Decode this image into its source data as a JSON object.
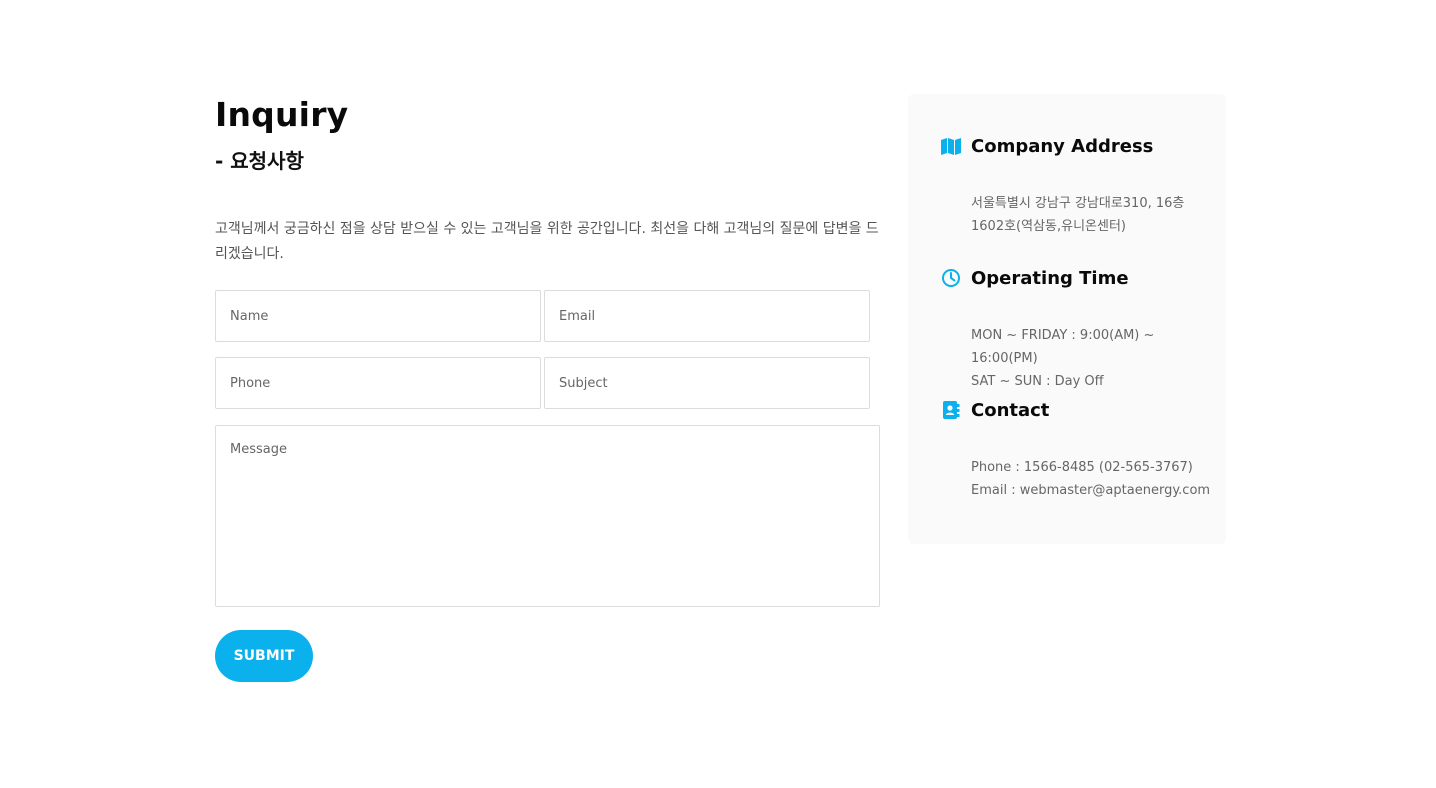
{
  "heading": {
    "title": "Inquiry",
    "subtitle": "- 요청사항",
    "description": "고객님께서 궁금하신 점을 상담 받으실 수 있는 고객님을 위한 공간입니다. 최선을 다해 고객님의 질문에 답변을 드리겠습니다."
  },
  "form": {
    "name_placeholder": "Name",
    "email_placeholder": "Email",
    "phone_placeholder": "Phone",
    "subject_placeholder": "Subject",
    "message_placeholder": "Message",
    "submit_label": "SUBMIT"
  },
  "info": {
    "address": {
      "icon": "map-icon",
      "title": "Company Address",
      "line1": "서울특별시 강남구 강남대로310, 16층",
      "line2": "1602호(역삼동,유니온센터)"
    },
    "hours": {
      "icon": "clock-icon",
      "title": "Operating Time",
      "line1": "MON ~ FRIDAY : 9:00(AM) ~ 16:00(PM)",
      "line2": "SAT ~ SUN : Day Off"
    },
    "contact": {
      "icon": "contact-book-icon",
      "title": "Contact",
      "line1": "Phone : 1566-8485 (02-565-3767)",
      "line2": "Email : webmaster@aptaenergy.com"
    }
  },
  "colors": {
    "accent": "#0ab1ec",
    "card_bg": "#fafafa",
    "border": "#dcdcdc"
  }
}
